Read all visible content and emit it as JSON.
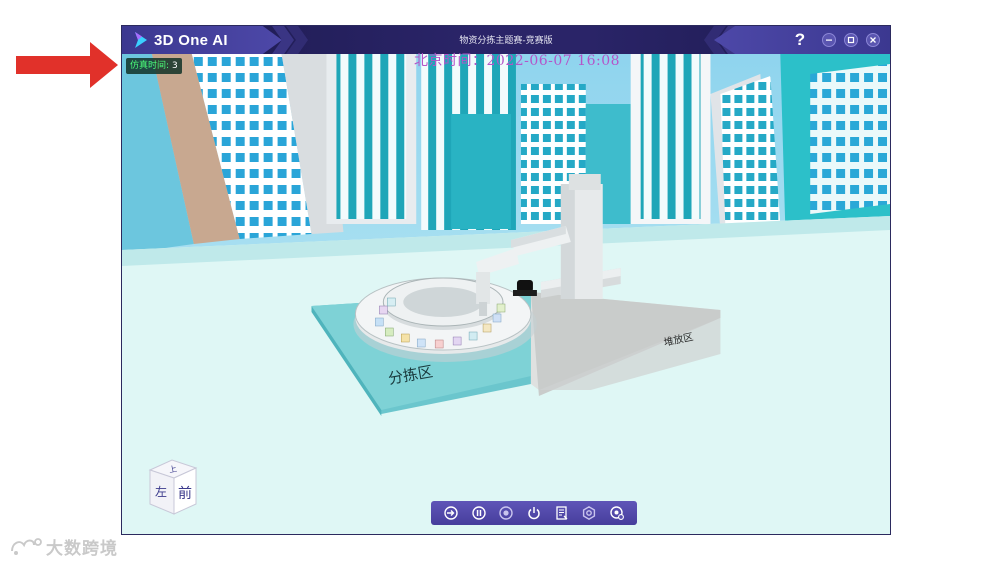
{
  "window": {
    "app_name": "3D One AI",
    "title": "物资分拣主题赛-竞赛版",
    "help_label": "?"
  },
  "overlay": {
    "sim_time_label": "仿真时间:",
    "sim_time_value": "3",
    "beijing_time": "北京时间：2022-06-07 16:08"
  },
  "scene": {
    "sorting_zone_label": "分拣区",
    "stacking_zone_label": "堆放区"
  },
  "nav_cube": {
    "top_label": "上",
    "left_label": "左",
    "front_label": "前"
  },
  "toolbar": {
    "buttons": [
      {
        "icon": "import-icon"
      },
      {
        "icon": "pause-icon"
      },
      {
        "icon": "record-icon"
      },
      {
        "icon": "power-icon"
      },
      {
        "icon": "document-icon"
      },
      {
        "icon": "settings-icon"
      },
      {
        "icon": "camera-settings-icon"
      }
    ]
  },
  "watermark": {
    "text": "大数跨境"
  },
  "colors": {
    "titlebar": "#2a2468",
    "toolbar": "#5a50b0",
    "sim_time_text": "#4cff7a",
    "beijing_time_text": "#b455c8",
    "annotation_arrow": "#e1312a"
  }
}
